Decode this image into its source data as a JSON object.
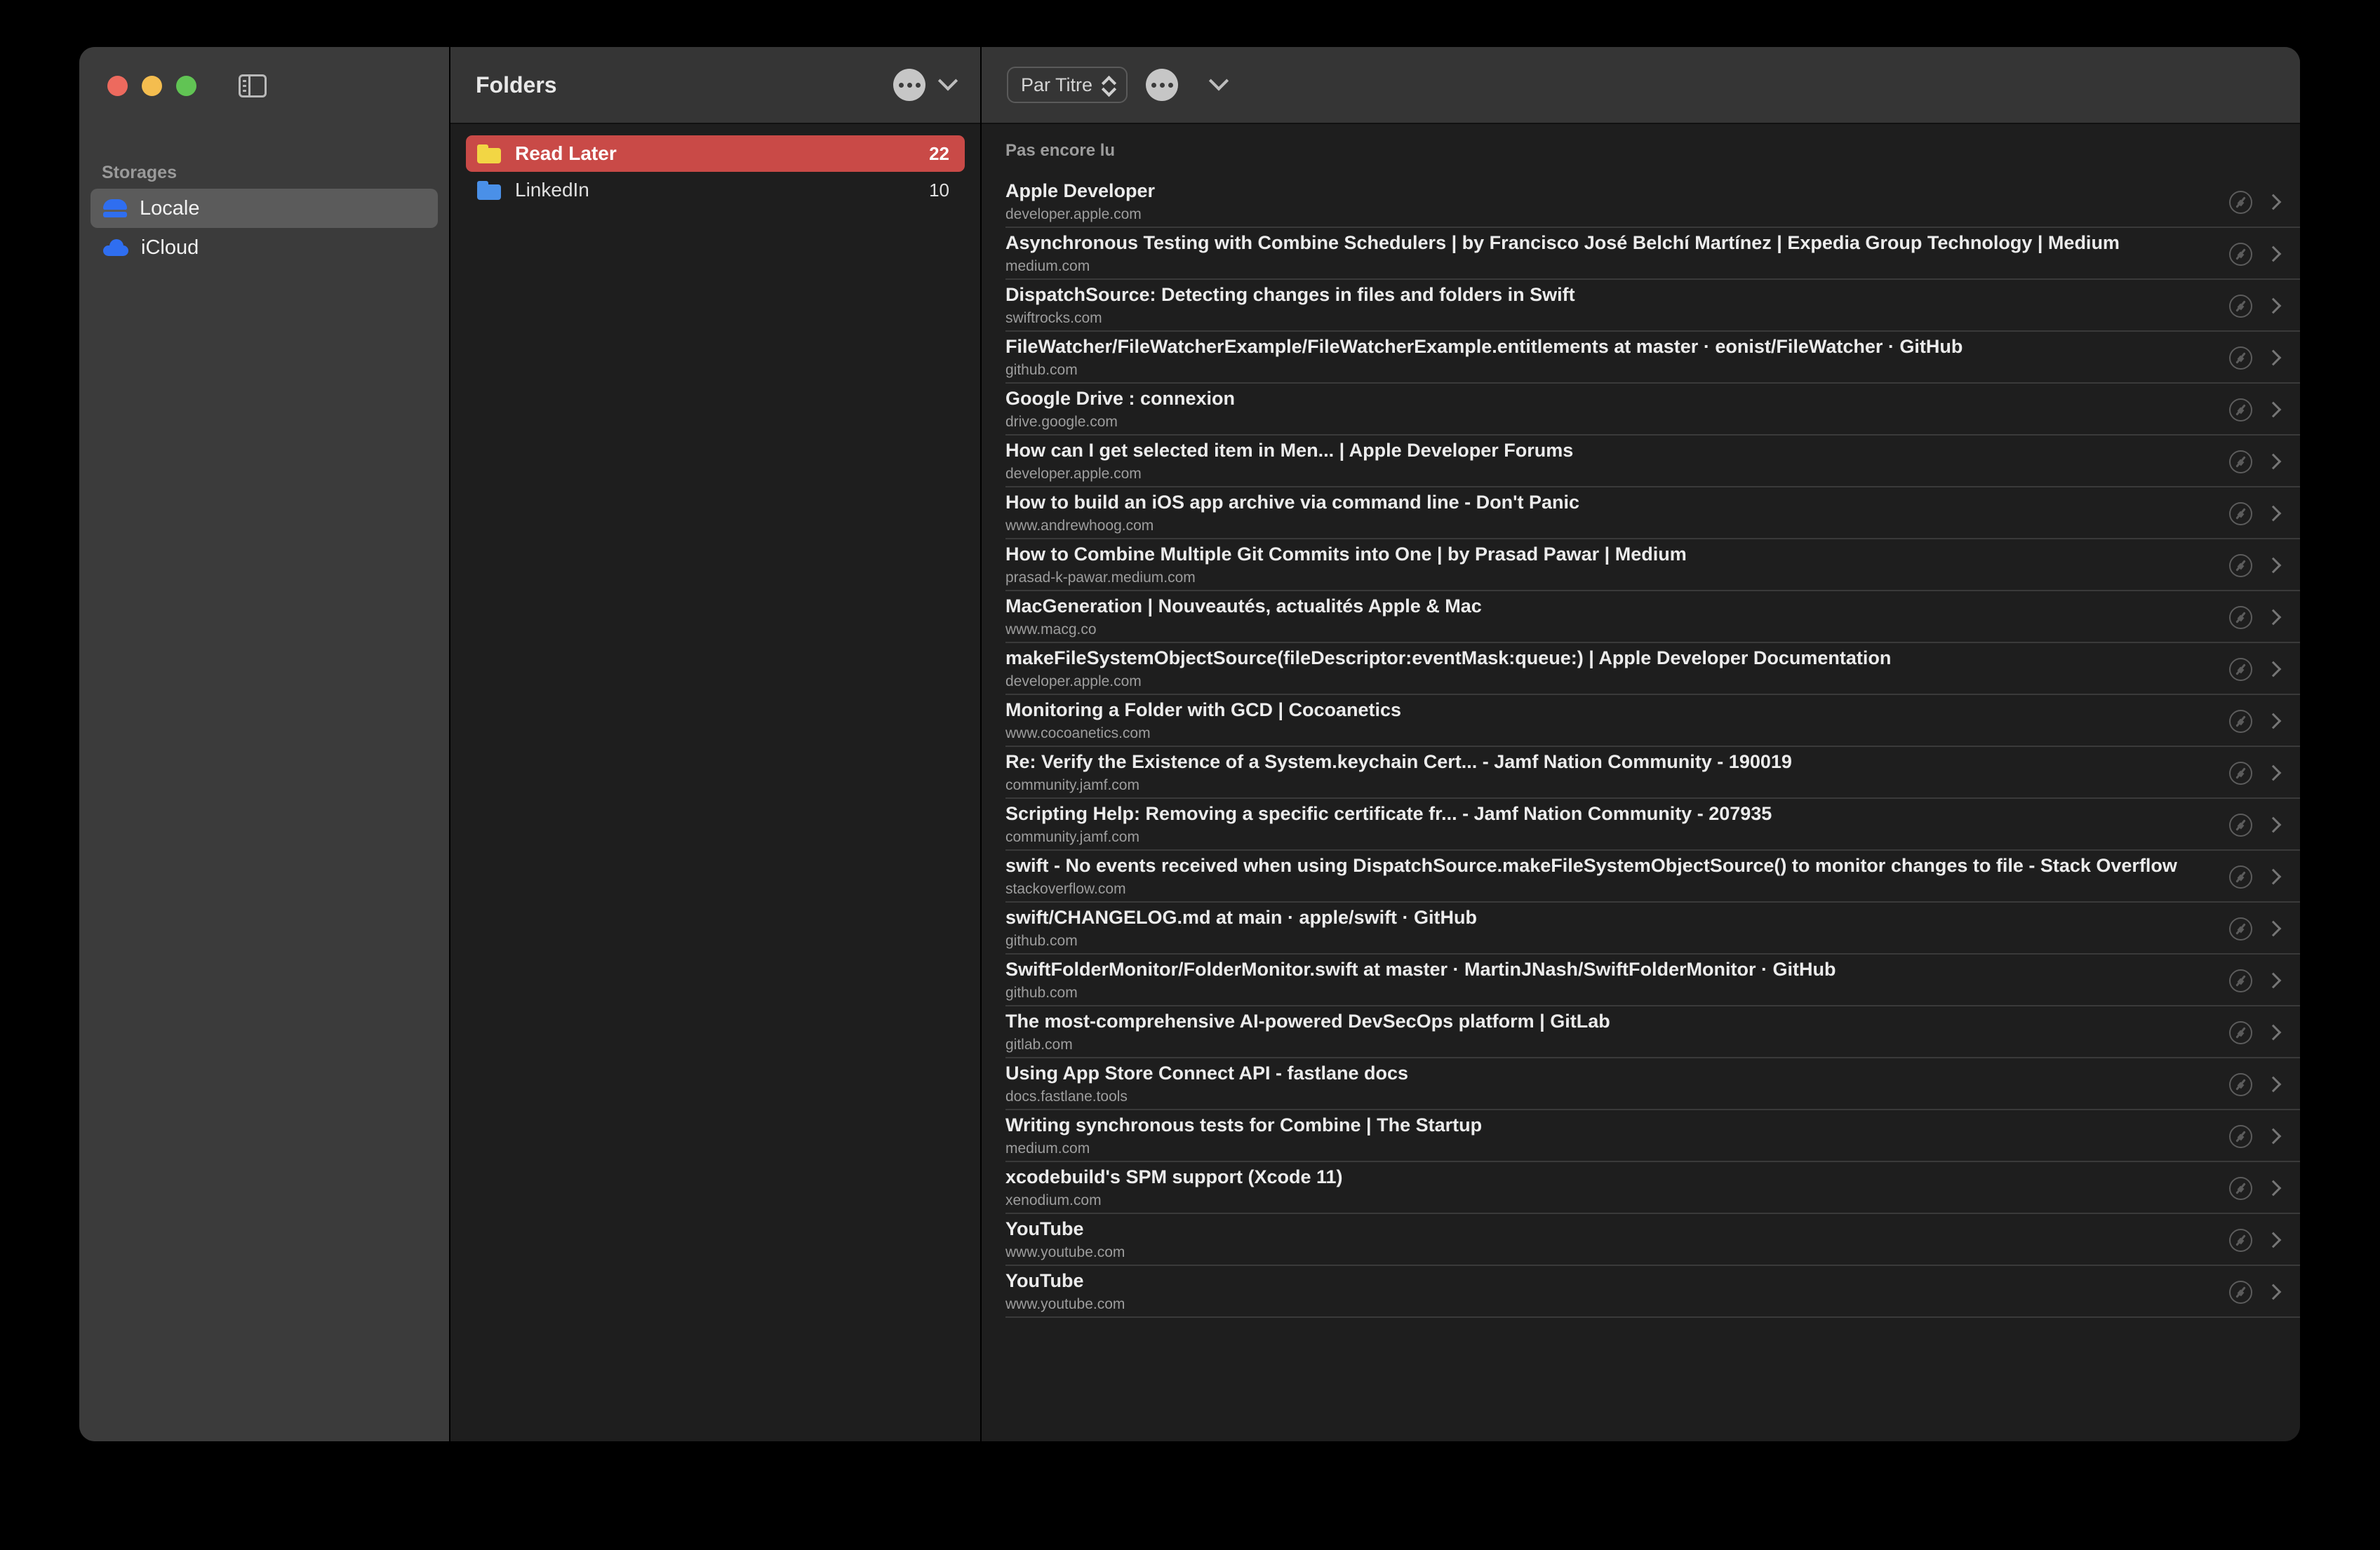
{
  "window": {
    "traffic_lights": [
      "close",
      "minimize",
      "zoom"
    ],
    "sidebar_toggle_icon": "sidebar-toggle-icon"
  },
  "sidebar": {
    "section_title": "Storages",
    "items": [
      {
        "label": "Locale",
        "icon": "drive-icon",
        "selected": true
      },
      {
        "label": "iCloud",
        "icon": "cloud-icon",
        "selected": false
      }
    ]
  },
  "folders_panel": {
    "title": "Folders",
    "menu_icon": "ellipsis-icon",
    "chevron_icon": "chevron-down-icon",
    "folders": [
      {
        "label": "Read Later",
        "count": "22",
        "color": "yellow",
        "selected": true
      },
      {
        "label": "LinkedIn",
        "count": "10",
        "color": "blue",
        "selected": false
      }
    ]
  },
  "list_panel": {
    "sort_label": "Par Titre",
    "sort_icon": "updown-stepper-icon",
    "menu_icon": "ellipsis-icon",
    "chevron_icon": "chevron-down-icon",
    "section_label": "Pas encore lu",
    "row_open_icon": "safari-compass-icon",
    "row_chevron_icon": "chevron-right-icon",
    "items": [
      {
        "title": "Apple Developer",
        "url": "developer.apple.com"
      },
      {
        "title": "Asynchronous Testing with Combine Schedulers | by Francisco José Belchí Martínez | Expedia Group Technology | Medium",
        "url": "medium.com"
      },
      {
        "title": "DispatchSource: Detecting changes in files and folders in Swift",
        "url": "swiftrocks.com"
      },
      {
        "title": "FileWatcher/FileWatcherExample/FileWatcherExample.entitlements at master · eonist/FileWatcher · GitHub",
        "url": "github.com"
      },
      {
        "title": "Google Drive : connexion",
        "url": "drive.google.com"
      },
      {
        "title": "How can I get selected item in Men... | Apple Developer Forums",
        "url": "developer.apple.com"
      },
      {
        "title": "How to build an iOS app archive via command line - Don't Panic",
        "url": "www.andrewhoog.com"
      },
      {
        "title": "How to Combine Multiple Git Commits into One | by Prasad Pawar | Medium",
        "url": "prasad-k-pawar.medium.com"
      },
      {
        "title": "MacGeneration | Nouveautés, actualités Apple & Mac",
        "url": "www.macg.co"
      },
      {
        "title": "makeFileSystemObjectSource(fileDescriptor:eventMask:queue:) | Apple Developer Documentation",
        "url": "developer.apple.com"
      },
      {
        "title": "Monitoring a Folder with GCD | Cocoanetics",
        "url": "www.cocoanetics.com"
      },
      {
        "title": "Re: Verify the Existence of a System.keychain Cert... - Jamf Nation Community - 190019",
        "url": "community.jamf.com"
      },
      {
        "title": "Scripting Help: Removing a specific certificate fr... - Jamf Nation Community - 207935",
        "url": "community.jamf.com"
      },
      {
        "title": "swift - No events received when using DispatchSource.makeFileSystemObjectSource() to monitor changes to file - Stack Overflow",
        "url": "stackoverflow.com"
      },
      {
        "title": "swift/CHANGELOG.md at main · apple/swift · GitHub",
        "url": "github.com"
      },
      {
        "title": "SwiftFolderMonitor/FolderMonitor.swift at master · MartinJNash/SwiftFolderMonitor · GitHub",
        "url": "github.com"
      },
      {
        "title": "The most-comprehensive AI-powered DevSecOps platform | GitLab",
        "url": "gitlab.com"
      },
      {
        "title": "Using App Store Connect API - fastlane docs",
        "url": "docs.fastlane.tools"
      },
      {
        "title": "Writing synchronous tests for Combine | The Startup",
        "url": "medium.com"
      },
      {
        "title": "xcodebuild's SPM support (Xcode 11)",
        "url": "xenodium.com"
      },
      {
        "title": "YouTube",
        "url": "www.youtube.com"
      },
      {
        "title": "YouTube",
        "url": "www.youtube.com"
      }
    ]
  },
  "colors": {
    "selected_folder": "#c94a47",
    "sidebar_bg": "#3b3b3b",
    "panel_bg": "#1e1e1e",
    "header_bg": "#353535"
  }
}
